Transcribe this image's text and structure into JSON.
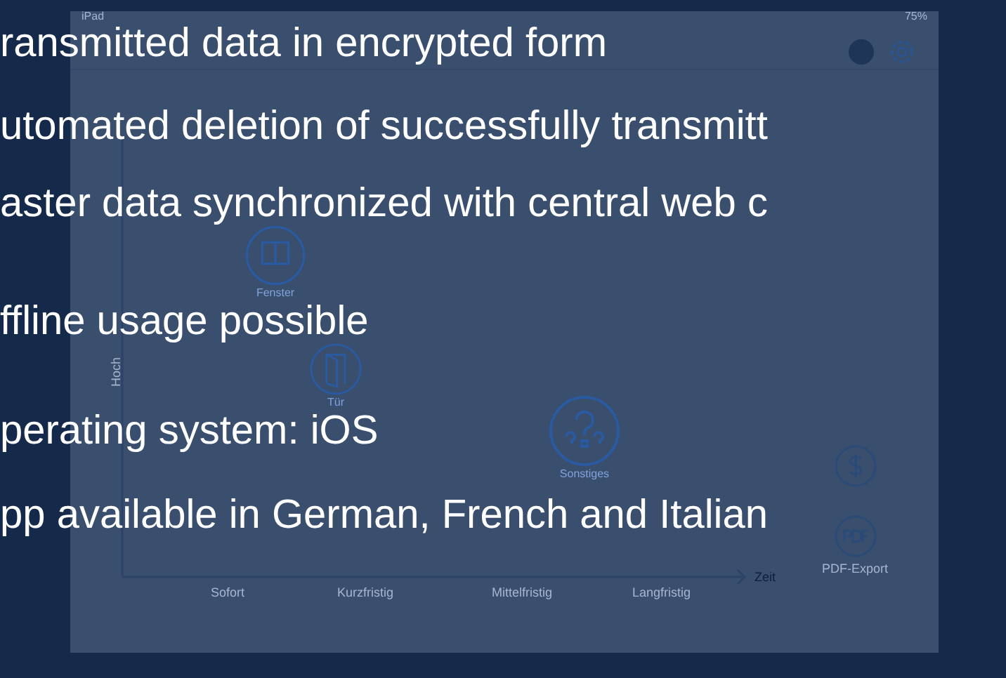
{
  "bullets": [
    "ransmitted data in encrypted form",
    "utomated deletion of successfully transmitt",
    "aster data synchronized with central web c",
    "ffline usage possible",
    "perating system: iOS",
    "pp available in German, French and Italian"
  ],
  "app": {
    "status_bar": {
      "device": "iPad",
      "battery": "75%"
    },
    "chart": {
      "y_axis_label": "Hoch",
      "x_axis_label": "Zeit",
      "columns": [
        "Sofort",
        "Kurzfristig",
        "Mittelfristig",
        "Langfristig"
      ],
      "items": [
        {
          "label": "Fenster",
          "kind": "window"
        },
        {
          "label": "Tür",
          "kind": "door"
        },
        {
          "label": "Sonstiges",
          "kind": "question"
        }
      ]
    },
    "side_actions": [
      {
        "kind": "cost"
      },
      {
        "label": "PDF-Export",
        "kind": "pdf"
      }
    ]
  }
}
